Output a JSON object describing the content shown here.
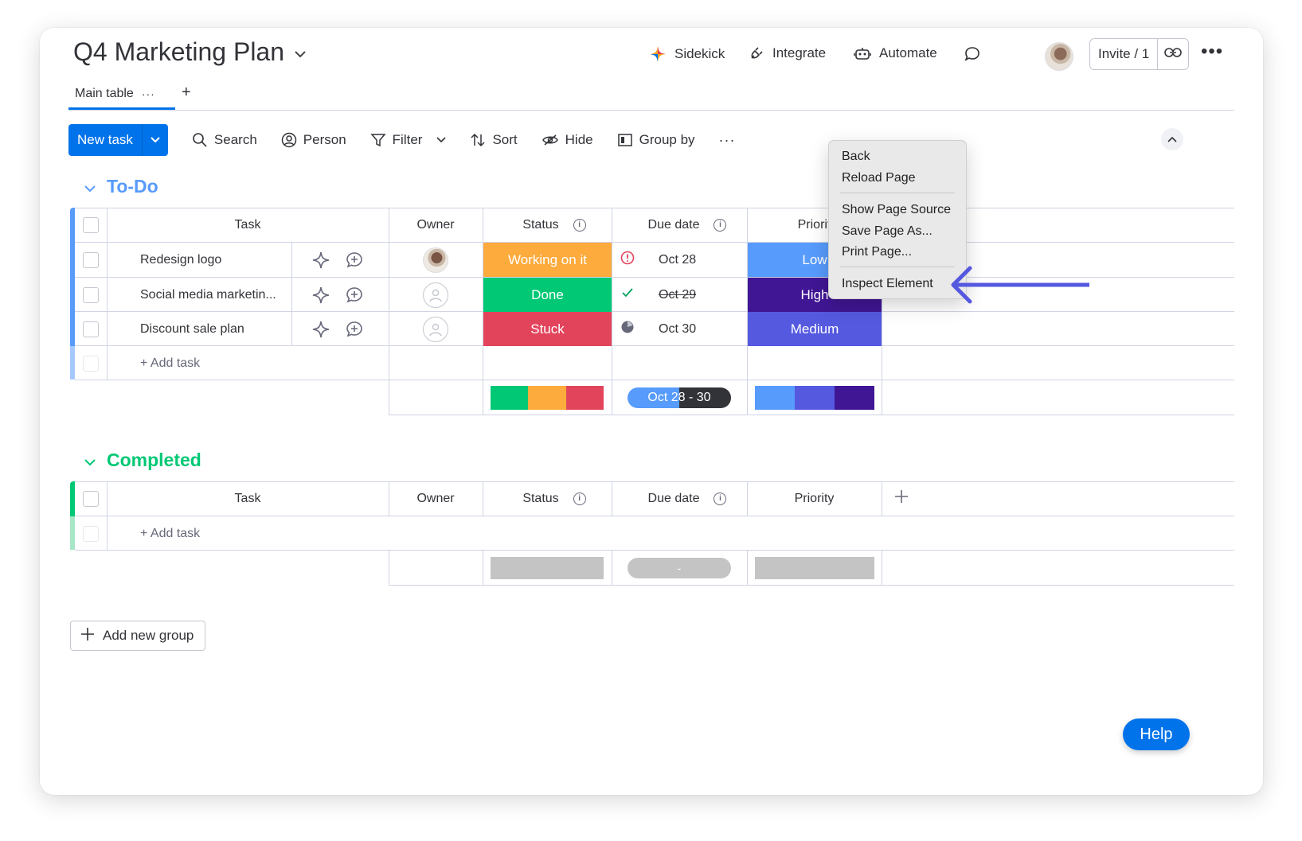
{
  "board": {
    "title": "Q4 Marketing Plan"
  },
  "header_actions": {
    "sidekick": "Sidekick",
    "integrate": "Integrate",
    "automate": "Automate",
    "invite": "Invite / 1"
  },
  "tabs": {
    "main": "Main table",
    "more": "···",
    "add": "+"
  },
  "toolbar": {
    "new_task": "New task",
    "search": "Search",
    "person": "Person",
    "filter": "Filter",
    "sort": "Sort",
    "hide": "Hide",
    "group_by": "Group by",
    "more": "···"
  },
  "columns": {
    "task": "Task",
    "owner": "Owner",
    "status": "Status",
    "due_date": "Due date",
    "priority": "Priority",
    "priority_partial": "Priorit"
  },
  "groups": [
    {
      "name": "To-Do",
      "color": "#579bfc",
      "rows": [
        {
          "task": "Redesign logo",
          "owner": "avatar",
          "status": "Working on it",
          "status_color": "#fdab3d",
          "due_icon": "alert-icon",
          "due": "Oct 28",
          "priority": "Low",
          "priority_color": "#579bfc"
        },
        {
          "task": "Social media marketin...",
          "owner": "empty",
          "status": "Done",
          "status_color": "#00c875",
          "due_icon": "check-icon",
          "due": "Oct 29",
          "priority": "High",
          "priority_color": "#401694"
        },
        {
          "task": "Discount sale plan",
          "owner": "empty",
          "status": "Stuck",
          "status_color": "#e2445c",
          "due_icon": "clock-icon",
          "due": "Oct 30",
          "priority": "Medium",
          "priority_color": "#5559df"
        }
      ],
      "add_task": "+ Add task",
      "summary": {
        "timeline": "Oct 28 - 30"
      }
    },
    {
      "name": "Completed",
      "color": "#00c875",
      "rows": [],
      "add_task": "+ Add task",
      "summary": {
        "timeline": "-"
      }
    }
  ],
  "context_menu": {
    "back": "Back",
    "reload": "Reload Page",
    "source": "Show Page Source",
    "save": "Save Page As...",
    "print": "Print Page...",
    "inspect": "Inspect Element"
  },
  "add_new_group": "Add new group",
  "help": "Help"
}
